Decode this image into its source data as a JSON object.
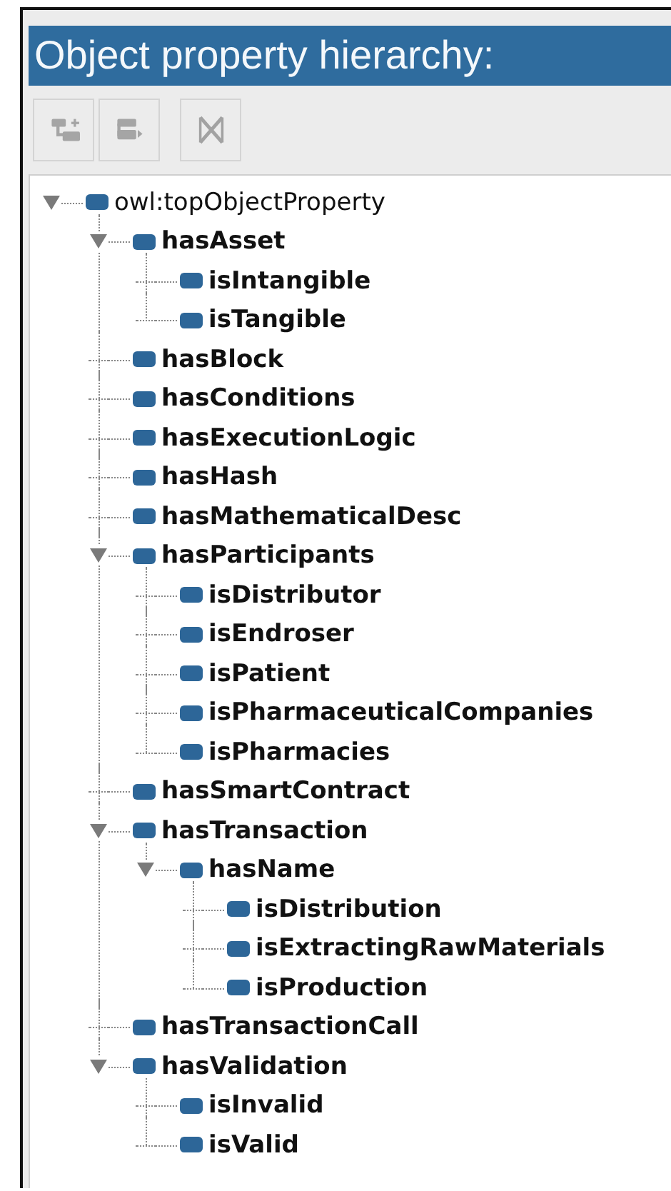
{
  "panel": {
    "title": "Object property hierarchy:"
  },
  "toolbar": [
    {
      "kind": "add-sub",
      "disabled": true
    },
    {
      "kind": "add-sibling",
      "disabled": true
    },
    {
      "kind": "delete",
      "disabled": true
    }
  ],
  "tree": [
    {
      "label": "owl:topObjectProperty",
      "expanded": true,
      "children": [
        {
          "label": "hasAsset",
          "expanded": true,
          "children": [
            {
              "label": "isIntangible"
            },
            {
              "label": "isTangible"
            }
          ]
        },
        {
          "label": "hasBlock"
        },
        {
          "label": "hasConditions"
        },
        {
          "label": "hasExecutionLogic"
        },
        {
          "label": "hasHash"
        },
        {
          "label": "hasMathematicalDesc"
        },
        {
          "label": "hasParticipants",
          "expanded": true,
          "children": [
            {
              "label": "isDistributor"
            },
            {
              "label": "isEndroser"
            },
            {
              "label": "isPatient"
            },
            {
              "label": "isPharmaceuticalCompanies"
            },
            {
              "label": "isPharmacies"
            }
          ]
        },
        {
          "label": "hasSmartContract"
        },
        {
          "label": "hasTransaction",
          "expanded": true,
          "children": [
            {
              "label": "hasName",
              "expanded": true,
              "children": [
                {
                  "label": "isDistribution"
                },
                {
                  "label": "isExtractingRawMaterials"
                },
                {
                  "label": "isProduction"
                }
              ]
            }
          ]
        },
        {
          "label": "hasTransactionCall"
        },
        {
          "label": "hasValidation",
          "expanded": true,
          "children": [
            {
              "label": "isInvalid"
            },
            {
              "label": "isValid"
            }
          ]
        }
      ]
    }
  ]
}
